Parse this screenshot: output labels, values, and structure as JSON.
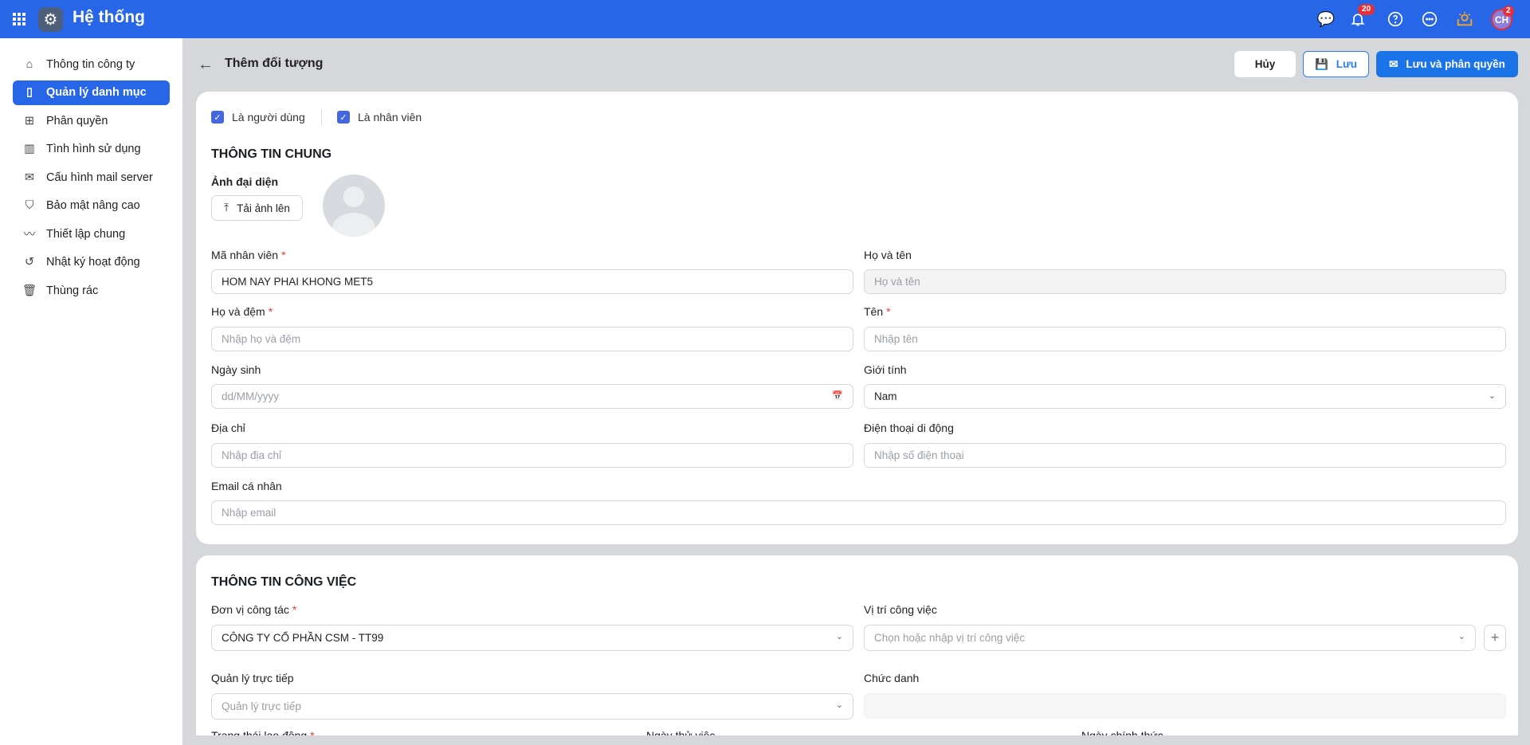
{
  "header": {
    "app_title": "Hệ thống",
    "notification_count": "20",
    "avatar_initials": "CH",
    "avatar_badge": "2"
  },
  "sidebar": {
    "items": [
      {
        "label": "Thông tin công ty",
        "icon": "home-icon"
      },
      {
        "label": "Quản lý danh mục",
        "icon": "category-icon",
        "active": true
      },
      {
        "label": "Phân quyền",
        "icon": "grid-plus-icon"
      },
      {
        "label": "Tình hình sử dụng",
        "icon": "bar-chart-icon"
      },
      {
        "label": "Cấu hình mail server",
        "icon": "mail-icon"
      },
      {
        "label": "Bảo mật nâng cao",
        "icon": "shield-icon"
      },
      {
        "label": "Thiết lập chung",
        "icon": "trend-icon"
      },
      {
        "label": "Nhật ký hoạt động",
        "icon": "history-icon"
      },
      {
        "label": "Thùng rác",
        "icon": "trash-icon"
      }
    ]
  },
  "page": {
    "title": "Thêm đối tượng",
    "cancel": "Hủy",
    "save": "Lưu",
    "save_and_assign": "Lưu và phân quyền"
  },
  "general": {
    "is_user": "Là người dùng",
    "is_employee": "Là nhân viên",
    "heading": "THÔNG TIN CHUNG",
    "avatar_label": "Ảnh đại diện",
    "upload": "Tải ảnh lên",
    "employee_code": {
      "label": "Mã nhân viên",
      "value": "HOM NAY PHAI KHONG MET5"
    },
    "full_name": {
      "label": "Họ và tên",
      "placeholder": "Họ và tên"
    },
    "last_middle": {
      "label": "Họ và đệm",
      "placeholder": "Nhập họ và đệm"
    },
    "first_name": {
      "label": "Tên",
      "placeholder": "Nhập tên"
    },
    "dob": {
      "label": "Ngày sinh",
      "placeholder": "dd/MM/yyyy"
    },
    "gender": {
      "label": "Giới tính",
      "value": "Nam"
    },
    "address": {
      "label": "Địa chỉ",
      "placeholder": "Nhập địa chỉ"
    },
    "phone": {
      "label": "Điện thoại di động",
      "placeholder": "Nhập số điện thoại"
    },
    "email": {
      "label": "Email cá nhân",
      "placeholder": "Nhập email"
    }
  },
  "work": {
    "heading": "THÔNG TIN CÔNG VIỆC",
    "unit": {
      "label": "Đơn vị công tác",
      "value": "CÔNG TY CỔ PHẦN CSM - TT99"
    },
    "position": {
      "label": "Vị trí công việc",
      "placeholder": "Chọn hoặc nhập vị trí công việc"
    },
    "manager": {
      "label": "Quản lý trực tiếp",
      "placeholder": "Quản lý trực tiếp"
    },
    "title": {
      "label": "Chức danh"
    },
    "status_label": "Trạng thái lao động",
    "probation_label": "Ngày thử việc",
    "official_label": "Ngày chính thức"
  }
}
